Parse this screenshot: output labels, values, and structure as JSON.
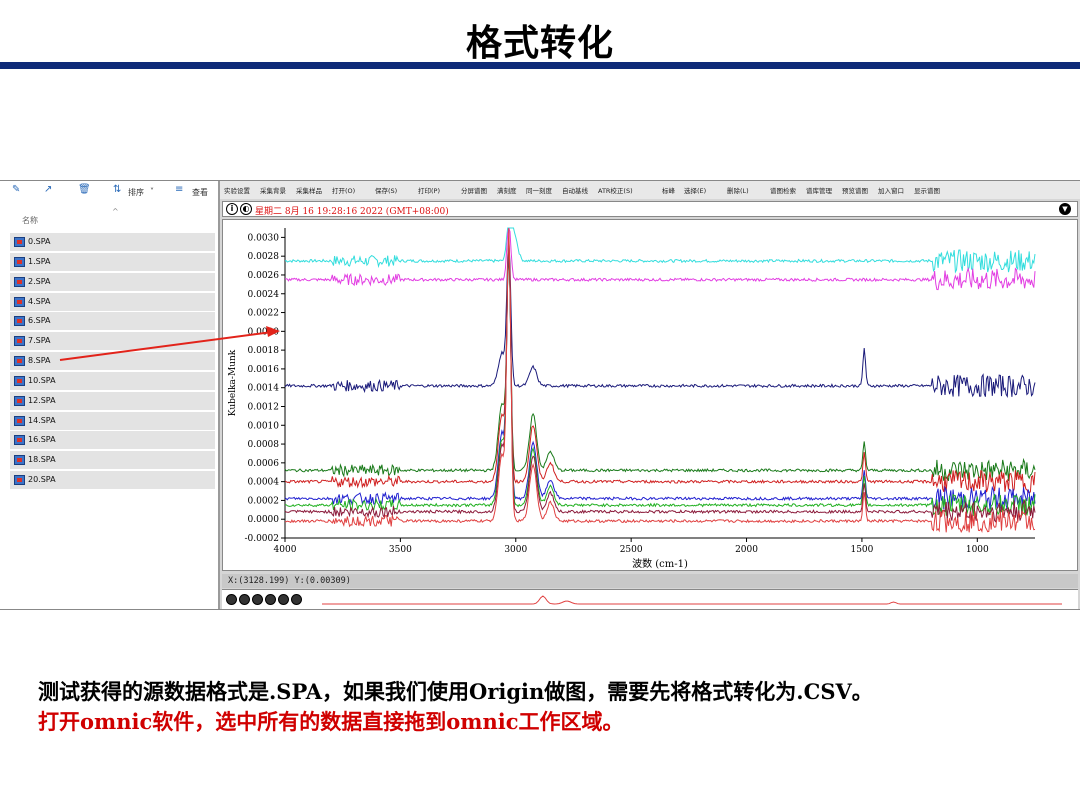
{
  "slide": {
    "title": "格式转化",
    "caption_line1": "测试获得的源数据格式是.SPA，如果我们使用Origin做图，需要先将格式转化为.CSV。",
    "caption_line2": "打开omnic软件，选中所有的数据直接拖到omnic工作区域。"
  },
  "explorer": {
    "toolbar": {
      "sort_label": "排序",
      "view_label": "查看"
    },
    "column_header": "名称",
    "files": [
      "0.SPA",
      "1.SPA",
      "2.SPA",
      "4.SPA",
      "6.SPA",
      "7.SPA",
      "8.SPA",
      "10.SPA",
      "12.SPA",
      "14.SPA",
      "16.SPA",
      "18.SPA",
      "20.SPA"
    ]
  },
  "omnic": {
    "menu": [
      "实验设置",
      "采集背景",
      "采集样品",
      "打开(O)",
      "保存(S)",
      "打印(P)",
      "分屏谱图",
      "满刻度",
      "同一刻度",
      "自动基线",
      "ATR校正(S)",
      "标峰",
      "选择(E)",
      "删除(L)",
      "谱图检索",
      "谱库管理",
      "预览谱图",
      "加入窗口",
      "显示谱图"
    ],
    "info_text": "星期二 8月 16 19:28:16 2022 (GMT+08:00)",
    "cursor_text": "X:(3128.199) Y:(0.00309)",
    "colors": {
      "red_text": "#dd1111",
      "arrow": "#e2231a",
      "title_rule": "#0e2a78"
    }
  },
  "chart_data": {
    "type": "line",
    "xlabel": "波数 (cm-1)",
    "ylabel": "Kubelka-Munk",
    "xlim": [
      4000,
      750
    ],
    "ylim": [
      -0.0002,
      0.0031
    ],
    "x_ticks": [
      "4000",
      "3500",
      "3000",
      "2500",
      "2000",
      "1500",
      "1000"
    ],
    "x_tick_values": [
      4000,
      3500,
      3000,
      2500,
      2000,
      1500,
      1000
    ],
    "y_ticks": [
      "0.0030",
      "0.0028",
      "0.0026",
      "0.0024",
      "0.0022",
      "0.0020",
      "0.0018",
      "0.0016",
      "0.0014",
      "0.0012",
      "0.0010",
      "0.0008",
      "0.0006",
      "0.0004",
      "0.0002",
      "0.0000",
      "-0.0002"
    ],
    "y_tick_values": [
      0.003,
      0.0028,
      0.0026,
      0.0024,
      0.0022,
      0.002,
      0.0018,
      0.0016,
      0.0014,
      0.0012,
      0.001,
      0.0008,
      0.0006,
      0.0004,
      0.0002,
      0.0,
      -0.0002
    ],
    "series": [
      {
        "color": "#33dddd",
        "baseline": 0.00275,
        "peaks": [
          [
            3030,
            0.0004
          ],
          [
            3010,
            0.00032
          ]
        ]
      },
      {
        "color": "#e23ee2",
        "baseline": 0.00255,
        "peaks": [
          [
            3030,
            0.0006
          ]
        ]
      },
      {
        "color": "#1a1a7a",
        "baseline": 0.00142,
        "peaks": [
          [
            3060,
            0.00035
          ],
          [
            3030,
            0.0015
          ],
          [
            2925,
            0.0002
          ],
          [
            1490,
            0.0004
          ]
        ]
      },
      {
        "color": "#1a7a1a",
        "baseline": 0.00052,
        "peaks": [
          [
            3060,
            0.0007
          ],
          [
            3030,
            0.0022
          ],
          [
            2925,
            0.0006
          ],
          [
            2850,
            0.0002
          ],
          [
            1490,
            0.0003
          ]
        ]
      },
      {
        "color": "#d02020",
        "baseline": 0.0004,
        "peaks": [
          [
            3060,
            0.0007
          ],
          [
            3030,
            0.0024
          ],
          [
            2925,
            0.0006
          ],
          [
            2850,
            0.0002
          ],
          [
            1490,
            0.0003
          ]
        ]
      },
      {
        "color": "#2020d0",
        "baseline": 0.00022,
        "peaks": [
          [
            3060,
            0.0007
          ],
          [
            3030,
            0.0026
          ],
          [
            2925,
            0.0006
          ],
          [
            2850,
            0.0002
          ],
          [
            1490,
            0.0003
          ]
        ]
      },
      {
        "color": "#20b020",
        "baseline": 0.00015,
        "peaks": [
          [
            3060,
            0.0007
          ],
          [
            3030,
            0.0027
          ],
          [
            2925,
            0.0006
          ],
          [
            2850,
            0.0002
          ],
          [
            1490,
            0.0003
          ]
        ]
      },
      {
        "color": "#8b1a3a",
        "baseline": 8e-05,
        "peaks": [
          [
            3060,
            0.0007
          ],
          [
            3030,
            0.0028
          ],
          [
            2925,
            0.0006
          ],
          [
            2850,
            0.0002
          ],
          [
            1490,
            0.0003
          ]
        ]
      },
      {
        "color": "#e04040",
        "baseline": -2e-05,
        "peaks": [
          [
            3060,
            0.0007
          ],
          [
            3030,
            0.003
          ],
          [
            2925,
            0.0006
          ],
          [
            2850,
            0.0002
          ],
          [
            1490,
            0.0003
          ]
        ]
      }
    ]
  }
}
